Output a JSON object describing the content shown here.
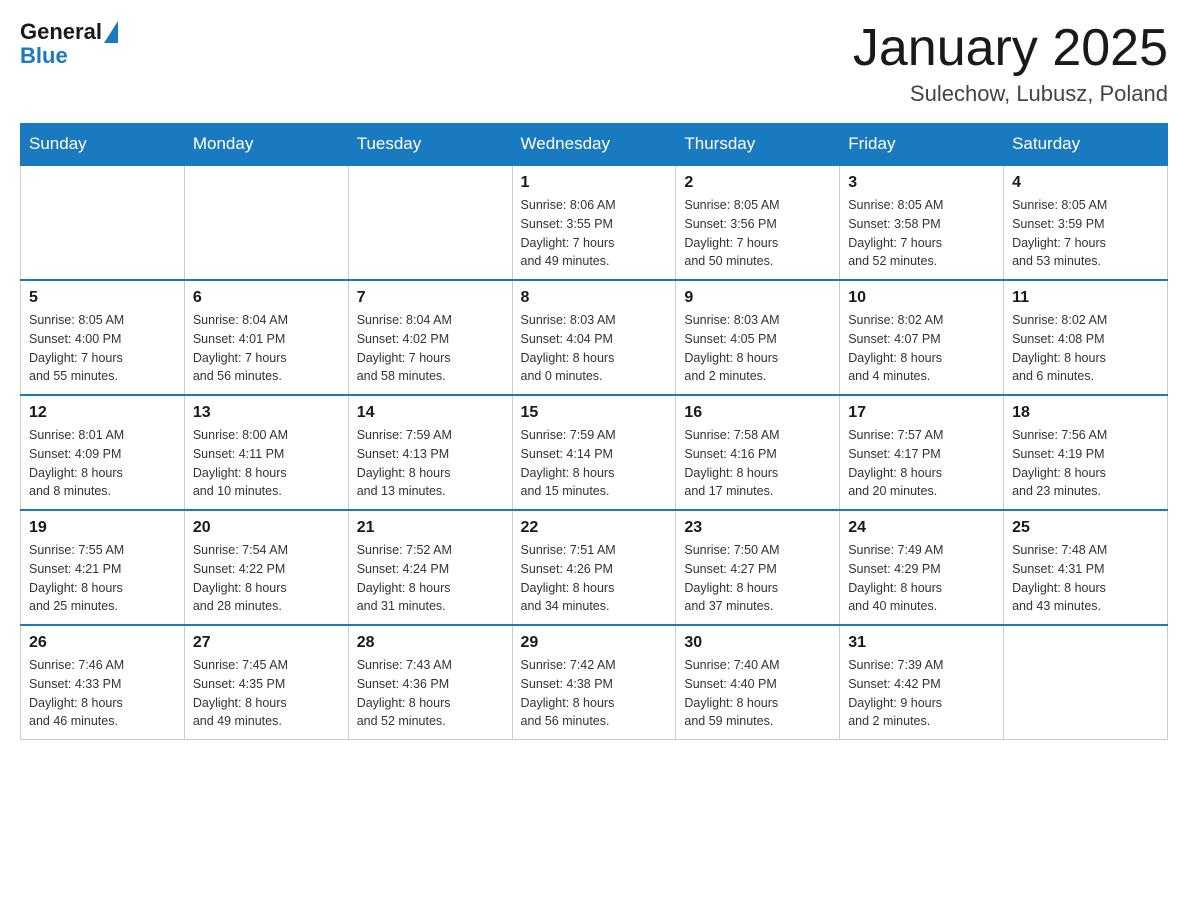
{
  "header": {
    "logo_general": "General",
    "logo_blue": "Blue",
    "title": "January 2025",
    "location": "Sulechow, Lubusz, Poland"
  },
  "days_of_week": [
    "Sunday",
    "Monday",
    "Tuesday",
    "Wednesday",
    "Thursday",
    "Friday",
    "Saturday"
  ],
  "weeks": [
    [
      {
        "day": "",
        "info": ""
      },
      {
        "day": "",
        "info": ""
      },
      {
        "day": "",
        "info": ""
      },
      {
        "day": "1",
        "info": "Sunrise: 8:06 AM\nSunset: 3:55 PM\nDaylight: 7 hours\nand 49 minutes."
      },
      {
        "day": "2",
        "info": "Sunrise: 8:05 AM\nSunset: 3:56 PM\nDaylight: 7 hours\nand 50 minutes."
      },
      {
        "day": "3",
        "info": "Sunrise: 8:05 AM\nSunset: 3:58 PM\nDaylight: 7 hours\nand 52 minutes."
      },
      {
        "day": "4",
        "info": "Sunrise: 8:05 AM\nSunset: 3:59 PM\nDaylight: 7 hours\nand 53 minutes."
      }
    ],
    [
      {
        "day": "5",
        "info": "Sunrise: 8:05 AM\nSunset: 4:00 PM\nDaylight: 7 hours\nand 55 minutes."
      },
      {
        "day": "6",
        "info": "Sunrise: 8:04 AM\nSunset: 4:01 PM\nDaylight: 7 hours\nand 56 minutes."
      },
      {
        "day": "7",
        "info": "Sunrise: 8:04 AM\nSunset: 4:02 PM\nDaylight: 7 hours\nand 58 minutes."
      },
      {
        "day": "8",
        "info": "Sunrise: 8:03 AM\nSunset: 4:04 PM\nDaylight: 8 hours\nand 0 minutes."
      },
      {
        "day": "9",
        "info": "Sunrise: 8:03 AM\nSunset: 4:05 PM\nDaylight: 8 hours\nand 2 minutes."
      },
      {
        "day": "10",
        "info": "Sunrise: 8:02 AM\nSunset: 4:07 PM\nDaylight: 8 hours\nand 4 minutes."
      },
      {
        "day": "11",
        "info": "Sunrise: 8:02 AM\nSunset: 4:08 PM\nDaylight: 8 hours\nand 6 minutes."
      }
    ],
    [
      {
        "day": "12",
        "info": "Sunrise: 8:01 AM\nSunset: 4:09 PM\nDaylight: 8 hours\nand 8 minutes."
      },
      {
        "day": "13",
        "info": "Sunrise: 8:00 AM\nSunset: 4:11 PM\nDaylight: 8 hours\nand 10 minutes."
      },
      {
        "day": "14",
        "info": "Sunrise: 7:59 AM\nSunset: 4:13 PM\nDaylight: 8 hours\nand 13 minutes."
      },
      {
        "day": "15",
        "info": "Sunrise: 7:59 AM\nSunset: 4:14 PM\nDaylight: 8 hours\nand 15 minutes."
      },
      {
        "day": "16",
        "info": "Sunrise: 7:58 AM\nSunset: 4:16 PM\nDaylight: 8 hours\nand 17 minutes."
      },
      {
        "day": "17",
        "info": "Sunrise: 7:57 AM\nSunset: 4:17 PM\nDaylight: 8 hours\nand 20 minutes."
      },
      {
        "day": "18",
        "info": "Sunrise: 7:56 AM\nSunset: 4:19 PM\nDaylight: 8 hours\nand 23 minutes."
      }
    ],
    [
      {
        "day": "19",
        "info": "Sunrise: 7:55 AM\nSunset: 4:21 PM\nDaylight: 8 hours\nand 25 minutes."
      },
      {
        "day": "20",
        "info": "Sunrise: 7:54 AM\nSunset: 4:22 PM\nDaylight: 8 hours\nand 28 minutes."
      },
      {
        "day": "21",
        "info": "Sunrise: 7:52 AM\nSunset: 4:24 PM\nDaylight: 8 hours\nand 31 minutes."
      },
      {
        "day": "22",
        "info": "Sunrise: 7:51 AM\nSunset: 4:26 PM\nDaylight: 8 hours\nand 34 minutes."
      },
      {
        "day": "23",
        "info": "Sunrise: 7:50 AM\nSunset: 4:27 PM\nDaylight: 8 hours\nand 37 minutes."
      },
      {
        "day": "24",
        "info": "Sunrise: 7:49 AM\nSunset: 4:29 PM\nDaylight: 8 hours\nand 40 minutes."
      },
      {
        "day": "25",
        "info": "Sunrise: 7:48 AM\nSunset: 4:31 PM\nDaylight: 8 hours\nand 43 minutes."
      }
    ],
    [
      {
        "day": "26",
        "info": "Sunrise: 7:46 AM\nSunset: 4:33 PM\nDaylight: 8 hours\nand 46 minutes."
      },
      {
        "day": "27",
        "info": "Sunrise: 7:45 AM\nSunset: 4:35 PM\nDaylight: 8 hours\nand 49 minutes."
      },
      {
        "day": "28",
        "info": "Sunrise: 7:43 AM\nSunset: 4:36 PM\nDaylight: 8 hours\nand 52 minutes."
      },
      {
        "day": "29",
        "info": "Sunrise: 7:42 AM\nSunset: 4:38 PM\nDaylight: 8 hours\nand 56 minutes."
      },
      {
        "day": "30",
        "info": "Sunrise: 7:40 AM\nSunset: 4:40 PM\nDaylight: 8 hours\nand 59 minutes."
      },
      {
        "day": "31",
        "info": "Sunrise: 7:39 AM\nSunset: 4:42 PM\nDaylight: 9 hours\nand 2 minutes."
      },
      {
        "day": "",
        "info": ""
      }
    ]
  ]
}
